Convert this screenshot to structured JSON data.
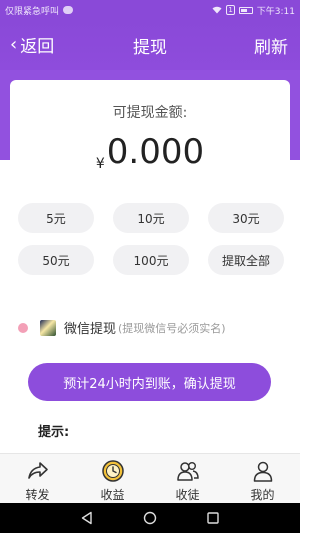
{
  "status_bar": {
    "carrier_text": "仅限紧急呼叫",
    "sim_label": "1",
    "time": "下午3:11"
  },
  "header": {
    "back_label": "返回",
    "title": "提现",
    "refresh_label": "刷新",
    "color": "#8a49d8"
  },
  "balance": {
    "label": "可提现金额:",
    "currency": "¥",
    "amount": "0.000"
  },
  "options": [
    "5元",
    "10元",
    "30元",
    "50元",
    "100元",
    "提取全部"
  ],
  "method": {
    "name": "微信提现",
    "note": "(提现微信号必须实名)",
    "radio_color": "#f3a0b7"
  },
  "confirm_button": "预计24小时内到账，确认提现",
  "tips_title": "提示:",
  "tabs": [
    {
      "label": "转发",
      "icon": "share-icon"
    },
    {
      "label": "收益",
      "icon": "coin-clock-icon"
    },
    {
      "label": "收徒",
      "icon": "users-icon"
    },
    {
      "label": "我的",
      "icon": "profile-icon"
    }
  ],
  "nav_bar": {
    "back": "back-triangle-icon",
    "home": "home-circle-icon",
    "recents": "recents-square-icon"
  }
}
